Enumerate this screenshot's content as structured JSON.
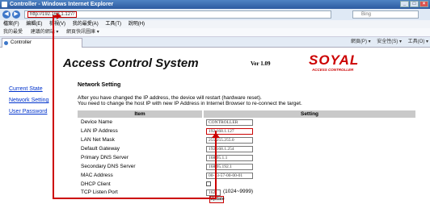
{
  "window": {
    "title": "Controller - Windows Internet Explorer"
  },
  "address": {
    "url": "http://192.168.1.127/",
    "search_placeholder": "Bing"
  },
  "menu": [
    "檔案(F)",
    "編輯(E)",
    "檢視(V)",
    "我的最愛(A)",
    "工具(T)",
    "說明(H)"
  ],
  "favorites": [
    "我的最愛",
    "建議的網站 ▾",
    "網頁快訊圖庫 ▾"
  ],
  "tab": {
    "label": "Controller"
  },
  "commandbar": [
    "網頁(P) ▾",
    "安全性(S) ▾",
    "工具(O) ▾"
  ],
  "page": {
    "title": "Access Control System",
    "version": "Ver 1.09",
    "logo": "SOYAL",
    "logo_sub": "ACCESS CONTROLLER"
  },
  "sidebar": {
    "items": [
      {
        "label": "Current State"
      },
      {
        "label": "Network Setting"
      },
      {
        "label": "User Password"
      }
    ]
  },
  "section": {
    "title": "Network Setting",
    "info1": "After you have changed the IP address, the device will restart (hardware reset).",
    "info2": "You need to change the host IP with new IP Address in Internet Browser to re-connect the target."
  },
  "table": {
    "headers": {
      "item": "Item",
      "setting": "Setting"
    },
    "rows": [
      {
        "label": "Device Name",
        "value": "CONTROLLER"
      },
      {
        "label": "LAN IP Address",
        "value": "192.168.1.127"
      },
      {
        "label": "LAN Net Mask",
        "value": "255.255.255.0"
      },
      {
        "label": "Default Gateway",
        "value": "192.168.1.254"
      },
      {
        "label": "Primary DNS Server",
        "value": "168.95.1.1"
      },
      {
        "label": "Secondary DNS Server",
        "value": "168.95.192.1"
      },
      {
        "label": "MAC Address",
        "value": "00-13-57-00-00-01"
      },
      {
        "label": "DHCP Client",
        "value": ""
      },
      {
        "label": "TCP Listen Port",
        "value": "1621"
      }
    ],
    "port_range": "(1024~9999)"
  },
  "update_button": "Update",
  "colors": {
    "accent_red": "#cc0000",
    "link_blue": "#0033cc",
    "header_gray": "#c9c9c9"
  }
}
